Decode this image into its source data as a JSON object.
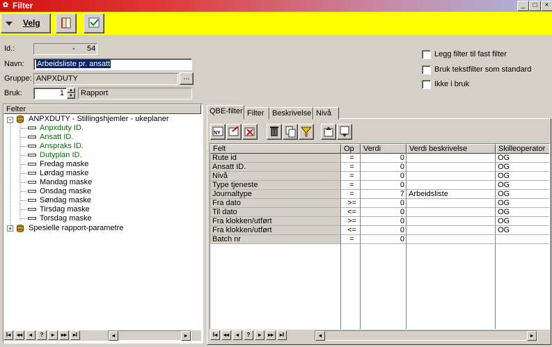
{
  "window": {
    "title": "Filter",
    "app_icon": "app-logo-icon",
    "buttons": [
      "_",
      "□",
      "×"
    ]
  },
  "toolbar": {
    "velg_label": "Velg"
  },
  "form": {
    "id_label": "Id.:",
    "id_value": "54",
    "id_dash": "-",
    "navn_label": "Navn:",
    "navn_value": "Arbeidsliste pr. ansatt",
    "gruppe_label": "Gruppe:",
    "gruppe_value": "ANPXDUTY",
    "gruppe_button": "...",
    "bruk_label": "Bruk:",
    "bruk_value": "1",
    "bruk_text": "Rapport"
  },
  "options": [
    {
      "label": "Legg filter til fast filter",
      "checked": false
    },
    {
      "label": "Bruk tekstfilter som standard",
      "checked": false
    },
    {
      "label": "Ikke i bruk",
      "checked": false
    }
  ],
  "tree": {
    "header": "Felter",
    "root": "ANPXDUTY - Stillingshjemler - ukeplaner",
    "children": [
      "Anpxduty ID.",
      "Ansatt ID.",
      "Anspraks ID.",
      "Dutyplan ID.",
      "Fredag maske",
      "Lørdag maske",
      "Mandag maske",
      "Onsdag maske",
      "Søndag maske",
      "Tirsdag maske",
      "Torsdag maske"
    ],
    "second_root": "Spesielle rapport-parametre"
  },
  "tabs": [
    "QBE-filter",
    "Filter",
    "Beskrivelse",
    "Nivå"
  ],
  "grid": {
    "columns": [
      "Felt",
      "Op",
      "Verdi",
      "Verdi beskrivelse",
      "Skilleoperator"
    ],
    "rows": [
      {
        "felt": "Rute id",
        "op": "=",
        "verdi": "0",
        "beskr": "",
        "skille": "OG"
      },
      {
        "felt": "Ansatt ID.",
        "op": "=",
        "verdi": "0",
        "beskr": "",
        "skille": "OG"
      },
      {
        "felt": "Nivå",
        "op": "=",
        "verdi": "0",
        "beskr": "",
        "skille": "OG"
      },
      {
        "felt": "Type tjeneste",
        "op": "=",
        "verdi": "0",
        "beskr": "",
        "skille": "OG"
      },
      {
        "felt": "Journaltype",
        "op": "=",
        "verdi": "7",
        "beskr": "Arbeidsliste",
        "skille": "OG"
      },
      {
        "felt": "Fra dato",
        "op": ">=",
        "verdi": "0",
        "beskr": "",
        "skille": "OG"
      },
      {
        "felt": "Til dato",
        "op": "<=",
        "verdi": "0",
        "beskr": "",
        "skille": "OG"
      },
      {
        "felt": "Fra klokken/utført",
        "op": ">=",
        "verdi": "0",
        "beskr": "",
        "skille": "OG"
      },
      {
        "felt": "Fra klokken/utført",
        "op": "<=",
        "verdi": "0",
        "beskr": "",
        "skille": "OG"
      },
      {
        "felt": "Batch nr",
        "op": "=",
        "verdi": "0",
        "beskr": "",
        "skille": ""
      }
    ]
  },
  "nav_labels": [
    "I◂",
    "◂◂",
    "◂",
    "?",
    "▸",
    "▸▸",
    "▸I"
  ]
}
